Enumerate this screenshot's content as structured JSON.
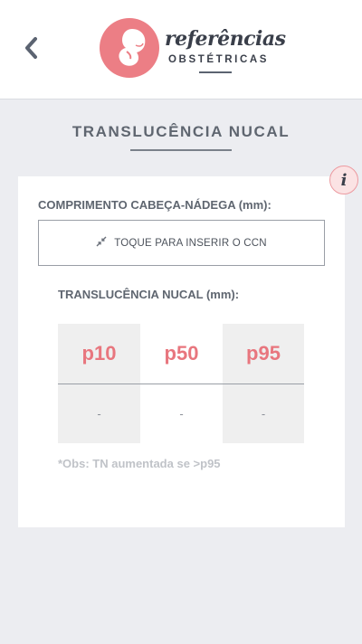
{
  "header": {
    "back_icon": "chevron-left-icon",
    "logo": {
      "script_text": "referências",
      "sub_text": "OBSTÉTRICAS",
      "icon": "fetus-icon",
      "accent_color": "#ec7e85"
    }
  },
  "page": {
    "title": "TRANSLUCÊNCIA NUCAL"
  },
  "info_button": {
    "label": "i",
    "icon": "info-icon"
  },
  "crl": {
    "label": "COMPRIMENTO CABEÇA-NÁDEGA (mm):",
    "input_icon": "compress-arrows-icon",
    "input_text": "TOQUE PARA INSERIR O CCN"
  },
  "nt": {
    "label": "TRANSLUCÊNCIA NUCAL (mm):",
    "percentiles": [
      {
        "name": "p10",
        "value": "-"
      },
      {
        "name": "p50",
        "value": "-"
      },
      {
        "name": "p95",
        "value": "-"
      }
    ],
    "highlight_color": "#e8767e"
  },
  "note": {
    "text": "*Obs: TN aumentada se >p95"
  }
}
